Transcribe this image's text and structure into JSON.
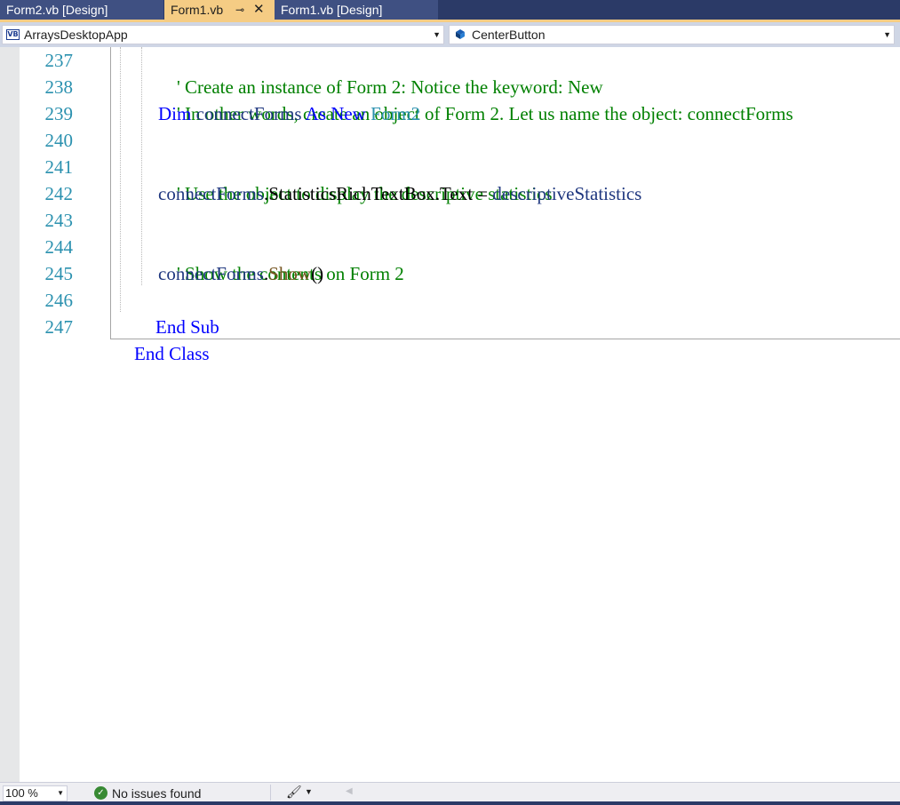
{
  "tabs": [
    {
      "label": "Form2.vb [Design]",
      "active": false
    },
    {
      "label": "Form1.vb",
      "active": true,
      "pin_glyph": "⊸",
      "close_glyph": "✕"
    },
    {
      "label": "Form1.vb [Design]",
      "active": false
    }
  ],
  "navbar": {
    "project_icon": "VB",
    "project": "ArraysDesktopApp",
    "member": "CenterButton",
    "dropdown_glyph": "▼"
  },
  "editor": {
    "lines": [
      {
        "number": "237",
        "segments": [
          {
            "text": "' Create an instance of Form 2: Notice the keyword: New",
            "kind": "comment"
          }
        ]
      },
      {
        "number": "238",
        "segments": [
          {
            "text": "' In other words, create an object of Form 2. Let us name the object: connectForms",
            "kind": "comment"
          }
        ]
      },
      {
        "number": "239",
        "segments": [
          {
            "text": "Dim",
            "kind": "keyword"
          },
          {
            "text": " connectForms ",
            "kind": "identifier"
          },
          {
            "text": "As New",
            "kind": "keyword"
          },
          {
            "text": " Form2",
            "kind": "type"
          }
        ]
      },
      {
        "number": "240",
        "segments": []
      },
      {
        "number": "241",
        "segments": [
          {
            "text": "' Use the object to display the descriptive statistics",
            "kind": "comment"
          }
        ]
      },
      {
        "number": "242",
        "segments": [
          {
            "text": "connectForms",
            "kind": "identifier"
          },
          {
            "text": ".StatisticsRichTextBox.Text = ",
            "kind": "plain"
          },
          {
            "text": "descriptiveStatistics",
            "kind": "identifier"
          }
        ]
      },
      {
        "number": "243",
        "segments": []
      },
      {
        "number": "244",
        "segments": [
          {
            "text": "' Show the contents on Form 2",
            "kind": "comment"
          }
        ]
      },
      {
        "number": "245",
        "segments": [
          {
            "text": "connectForms",
            "kind": "identifier"
          },
          {
            "text": ".",
            "kind": "plain"
          },
          {
            "text": "Show",
            "kind": "method"
          },
          {
            "text": "()",
            "kind": "plain"
          }
        ]
      },
      {
        "number": "246",
        "segments": [
          {
            "text": "End Sub",
            "kind": "keyword"
          }
        ]
      },
      {
        "number": "247",
        "segments": [
          {
            "text": "End Class",
            "kind": "keyword"
          }
        ]
      }
    ]
  },
  "status": {
    "zoom": "100 %",
    "zoom_arrow": "▼",
    "ok_glyph": "✓",
    "issues": "No issues found",
    "brush_glyph": "🖌",
    "brush_arrow": "▼",
    "scroll_left_glyph": "◀"
  },
  "colors": {
    "tab_strip": "#2b3a67",
    "active_tab": "#f5cc84",
    "comment": "#008000",
    "keyword": "#0000ff",
    "type": "#2b91af",
    "line_number": "#2b91af"
  }
}
